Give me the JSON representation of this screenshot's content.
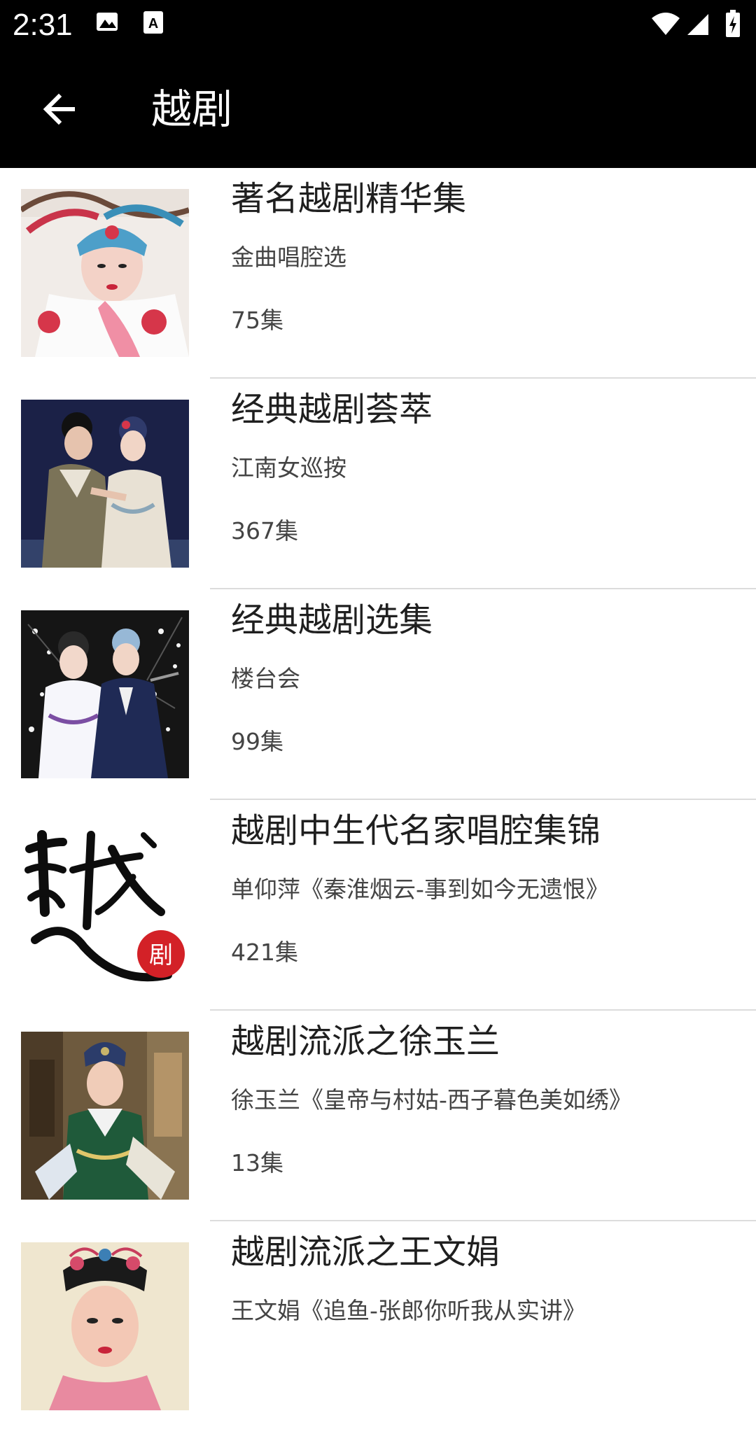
{
  "status_bar": {
    "time": "2:31",
    "icons": [
      "image-icon",
      "a-text-icon",
      "wifi-icon",
      "signal-icon",
      "battery-icon"
    ]
  },
  "app_bar": {
    "title": "越剧",
    "back_icon": "arrow-left-icon"
  },
  "items": [
    {
      "title": "著名越剧精华集",
      "subtitle": "金曲唱腔选",
      "count": "75集",
      "thumbnail": "opera-performer-photo"
    },
    {
      "title": "经典越剧荟萃",
      "subtitle": "江南女巡按",
      "count": "367集",
      "thumbnail": "opera-duo-photo"
    },
    {
      "title": "经典越剧选集",
      "subtitle": "楼台会",
      "count": "99集",
      "thumbnail": "opera-duo-blossom-photo"
    },
    {
      "title": "越剧中生代名家唱腔集锦",
      "subtitle": "单仰萍《秦淮烟云-事到如今无遗恨》",
      "count": "421集",
      "thumbnail": "calligraphy-logo",
      "logo_text": "越",
      "seal_text": "剧"
    },
    {
      "title": "越剧流派之徐玉兰",
      "subtitle": "徐玉兰《皇帝与村姑-西子暮色美如绣》",
      "count": "13集",
      "thumbnail": "opera-performer-green-robe-photo"
    },
    {
      "title": "越剧流派之王文娟",
      "subtitle": "王文娟《追鱼-张郎你听我从实讲》",
      "count": "",
      "thumbnail": "opera-performer-portrait-photo"
    }
  ],
  "colors": {
    "app_bar_bg": "#000000",
    "background": "#ffffff",
    "divider": "#dcdcdc"
  }
}
